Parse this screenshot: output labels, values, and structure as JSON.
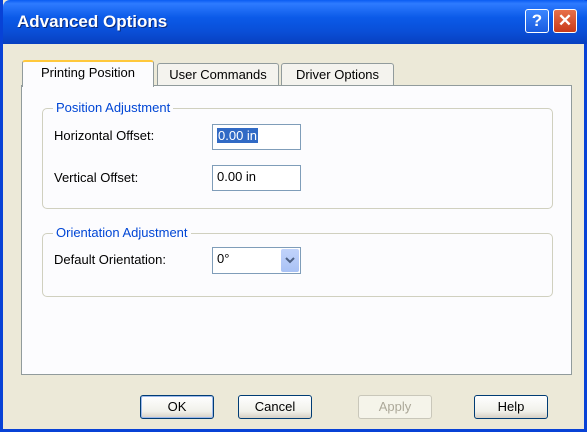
{
  "window": {
    "title": "Advanced Options",
    "help_glyph": "?",
    "close_glyph": "✕"
  },
  "tabs": [
    {
      "label": "Printing Position",
      "active": true
    },
    {
      "label": "User Commands",
      "active": false
    },
    {
      "label": "Driver Options",
      "active": false
    }
  ],
  "position_group": {
    "title": "Position Adjustment",
    "horizontal_label": "Horizontal Offset:",
    "horizontal_value": "0.00 in",
    "vertical_label": "Vertical Offset:",
    "vertical_value": "0.00 in"
  },
  "orientation_group": {
    "title": "Orientation Adjustment",
    "default_label": "Default Orientation:",
    "default_value": "0°"
  },
  "buttons": {
    "ok": "OK",
    "cancel": "Cancel",
    "apply": "Apply",
    "help": "Help"
  },
  "colors": {
    "title_bar": "#0A4FD8",
    "group_title": "#0046D5",
    "selection": "#316AC5",
    "active_tab_accent": "#FFC83C"
  }
}
